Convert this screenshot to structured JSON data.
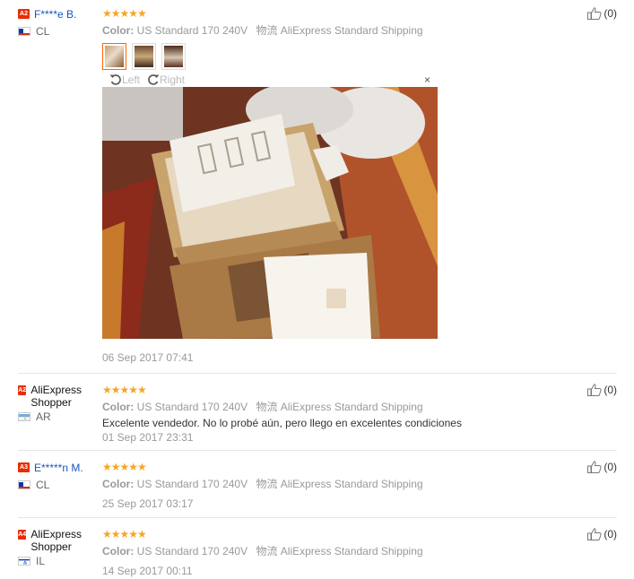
{
  "colors": {
    "accent": "#e62e04",
    "star": "#f5a623",
    "link": "#1a56bf",
    "muted": "#999999"
  },
  "reviews": [
    {
      "level": "A2",
      "name": "F****e B.",
      "country": "CL",
      "flag": "chile",
      "stars": "★★★★★",
      "color_label": "Color:",
      "color_value": "US Standard 170 240V",
      "logistics_label": "物流",
      "logistics_value": "AliExpress Standard Shipping",
      "date": "06 Sep 2017 07:41",
      "helpful": "(0)",
      "viewer": {
        "left": "Left",
        "right": "Right",
        "close": "×"
      }
    },
    {
      "level": "A2",
      "name": "AliExpress Shopper",
      "country": "AR",
      "flag": "argentina",
      "stars": "★★★★★",
      "color_label": "Color:",
      "color_value": "US Standard 170 240V",
      "logistics_label": "物流",
      "logistics_value": "AliExpress Standard Shipping",
      "text": "Excelente vendedor. No lo probé aún, pero llego en excelentes condiciones",
      "date": "01 Sep 2017 23:31",
      "helpful": "(0)"
    },
    {
      "level": "A3",
      "name": "E*****n M.",
      "country": "CL",
      "flag": "chile",
      "stars": "★★★★★",
      "color_label": "Color:",
      "color_value": "US Standard 170 240V",
      "logistics_label": "物流",
      "logistics_value": "AliExpress Standard Shipping",
      "date": "25 Sep 2017 03:17",
      "helpful": "(0)"
    },
    {
      "level": "A4",
      "name": "AliExpress Shopper",
      "country": "IL",
      "flag": "israel",
      "stars": "★★★★★",
      "color_label": "Color:",
      "color_value": "US Standard 170 240V",
      "logistics_label": "物流",
      "logistics_value": "AliExpress Standard Shipping",
      "date": "14 Sep 2017 00:11",
      "helpful": "(0)"
    }
  ]
}
